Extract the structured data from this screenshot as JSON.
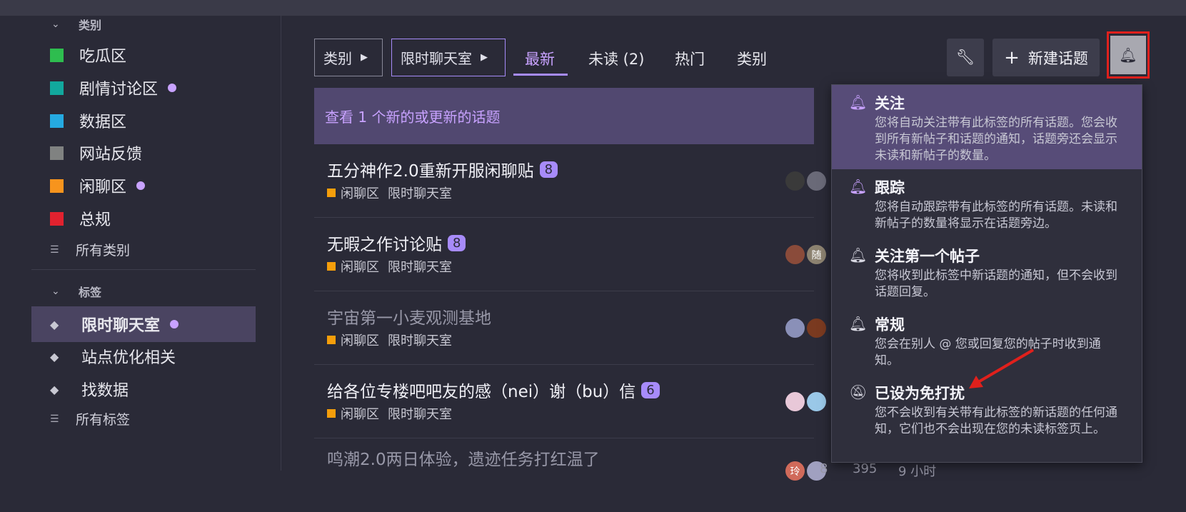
{
  "sidebar": {
    "categories_header": "类别",
    "categories": [
      {
        "label": "吃瓜区",
        "color": "#2ebd4f",
        "dot": false
      },
      {
        "label": "剧情讨论区",
        "color": "#12a89d",
        "dot": true
      },
      {
        "label": "数据区",
        "color": "#25aae1",
        "dot": false
      },
      {
        "label": "网站反馈",
        "color": "#808281",
        "dot": false
      },
      {
        "label": "闲聊区",
        "color": "#f7941d",
        "dot": true
      },
      {
        "label": "总规",
        "color": "#e1222f",
        "dot": false
      }
    ],
    "all_categories": "所有类别",
    "tags_header": "标签",
    "tags": [
      {
        "label": "限时聊天室",
        "active": true,
        "dot": true
      },
      {
        "label": "站点优化相关",
        "active": false,
        "dot": false
      },
      {
        "label": "找数据",
        "active": false,
        "dot": false
      }
    ],
    "all_tags": "所有标签"
  },
  "nav": {
    "crumb_category": "类别",
    "crumb_tag": "限时聊天室",
    "tabs": [
      "最新",
      "未读 (2)",
      "热门",
      "类别"
    ],
    "new_topic": "新建话题",
    "new_topic_icon": "plus-icon",
    "wrench_icon": "wrench-icon",
    "bell_icon": "bell-icon"
  },
  "banner": "查看 1 个新的或更新的话题",
  "topics": [
    {
      "title": "五分神作2.0重新开服闲聊贴",
      "count": "8",
      "category": "闲聊区",
      "tag": "限时聊天室",
      "read": false
    },
    {
      "title": "无暇之作讨论贴",
      "count": "8",
      "category": "闲聊区",
      "tag": "限时聊天室",
      "read": false
    },
    {
      "title": "宇宙第一小麦观测基地",
      "count": "",
      "category": "闲聊区",
      "tag": "限时聊天室",
      "read": true
    },
    {
      "title": "给各位专楼吧吧友的感（nei）谢（bu）信",
      "count": "6",
      "category": "闲聊区",
      "tag": "限时聊天室",
      "read": false
    },
    {
      "title": "鸣潮2.0两日体验，遗迹任务打红温了",
      "count": "",
      "category": "",
      "tag": "",
      "read": true
    }
  ],
  "avatar_letters": {
    "suibian": "随",
    "last_row": "玲",
    "replies": "8",
    "views": "395",
    "age": "9 小时"
  },
  "dropdown": [
    {
      "title": "关注",
      "desc": "您将自动关注带有此标签的所有话题。您会收到所有新帖子和话题的通知，话题旁还会显示未读和新帖子的数量。",
      "icon": "bell-alert-icon",
      "selected": true
    },
    {
      "title": "跟踪",
      "desc": "您将自动跟踪带有此标签的所有话题。未读和新帖子的数量将显示在话题旁边。",
      "icon": "bell-icon",
      "selected": false
    },
    {
      "title": "关注第一个帖子",
      "desc": "您将收到此标签中新话题的通知，但不会收到话题回复。",
      "icon": "bell-alert-icon",
      "selected": false
    },
    {
      "title": "常规",
      "desc": "您会在别人 @ 您或回复您的帖子时收到通知。",
      "icon": "bell-outline-icon",
      "selected": false
    },
    {
      "title": "已设为免打扰",
      "desc": "您不会收到有关带有此标签的新话题的任何通知，它们也不会出现在您的未读标签页上。",
      "icon": "bell-slash-icon",
      "selected": false
    }
  ],
  "colors": {
    "accent": "#a78bfa",
    "highlight_border": "#e0201c",
    "category_orange": "#f59e0b"
  }
}
